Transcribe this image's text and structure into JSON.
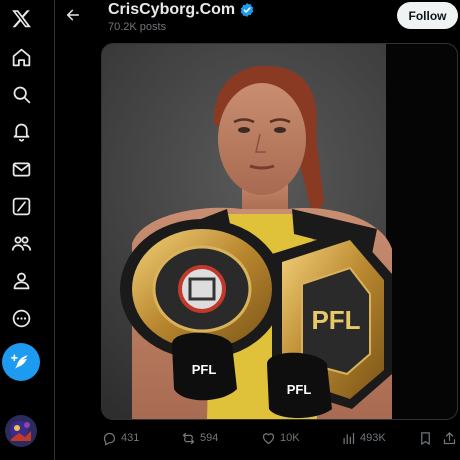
{
  "header": {
    "title": "CrisCyborg.Com",
    "subtitle": "70.2K posts",
    "follow_label": "Follow"
  },
  "media": {
    "alt_description_label": ""
  },
  "actions": {
    "replies": "431",
    "reposts": "594",
    "likes": "10K",
    "views": "493K"
  },
  "icons": {
    "logo": "x-logo-icon",
    "home": "home-icon",
    "explore": "search-icon",
    "notifications": "bell-icon",
    "messages": "mail-icon",
    "grok": "grok-icon",
    "communities": "people-icon",
    "profile": "person-icon",
    "more": "more-circle-icon",
    "post": "feather-plus-icon"
  },
  "colors": {
    "accent": "#1d9bf0",
    "background": "#000000",
    "text_primary": "#e7e9ea",
    "text_secondary": "#71767b",
    "follow_bg": "#eff3f4"
  }
}
